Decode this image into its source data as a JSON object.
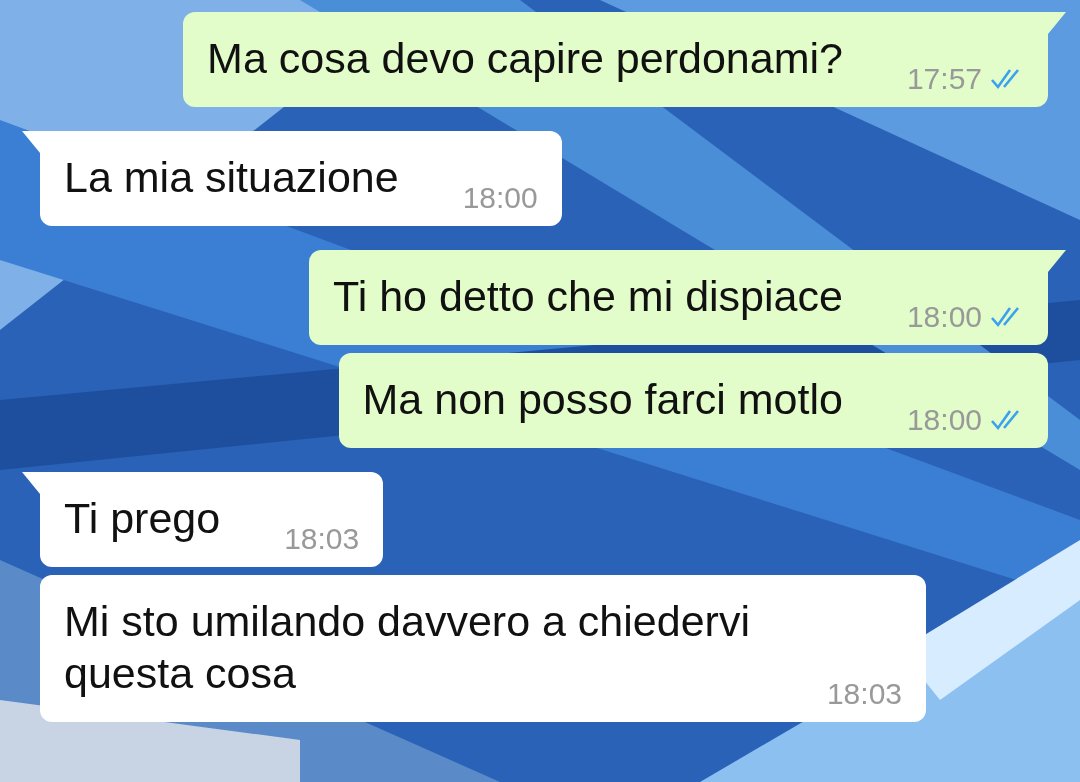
{
  "messages": [
    {
      "kind": "outgoing",
      "text": "Ma cosa devo capire perdonami?",
      "time": "17:57",
      "read": true,
      "tail": true
    },
    {
      "kind": "incoming",
      "text": "La mia situazione",
      "time": "18:00",
      "tail": true
    },
    {
      "kind": "outgoing",
      "text": "Ti ho detto che mi dispiace",
      "time": "18:00",
      "read": true,
      "tail": true
    },
    {
      "kind": "outgoing",
      "text": "Ma non posso farci motlo",
      "time": "18:00",
      "read": true,
      "tail": false
    },
    {
      "kind": "incoming",
      "text": "Ti prego",
      "time": "18:03",
      "tail": true
    },
    {
      "kind": "incoming",
      "text": "Mi sto umilando davvero a chiedervi questa cosa",
      "time": "18:03",
      "tail": false
    }
  ]
}
